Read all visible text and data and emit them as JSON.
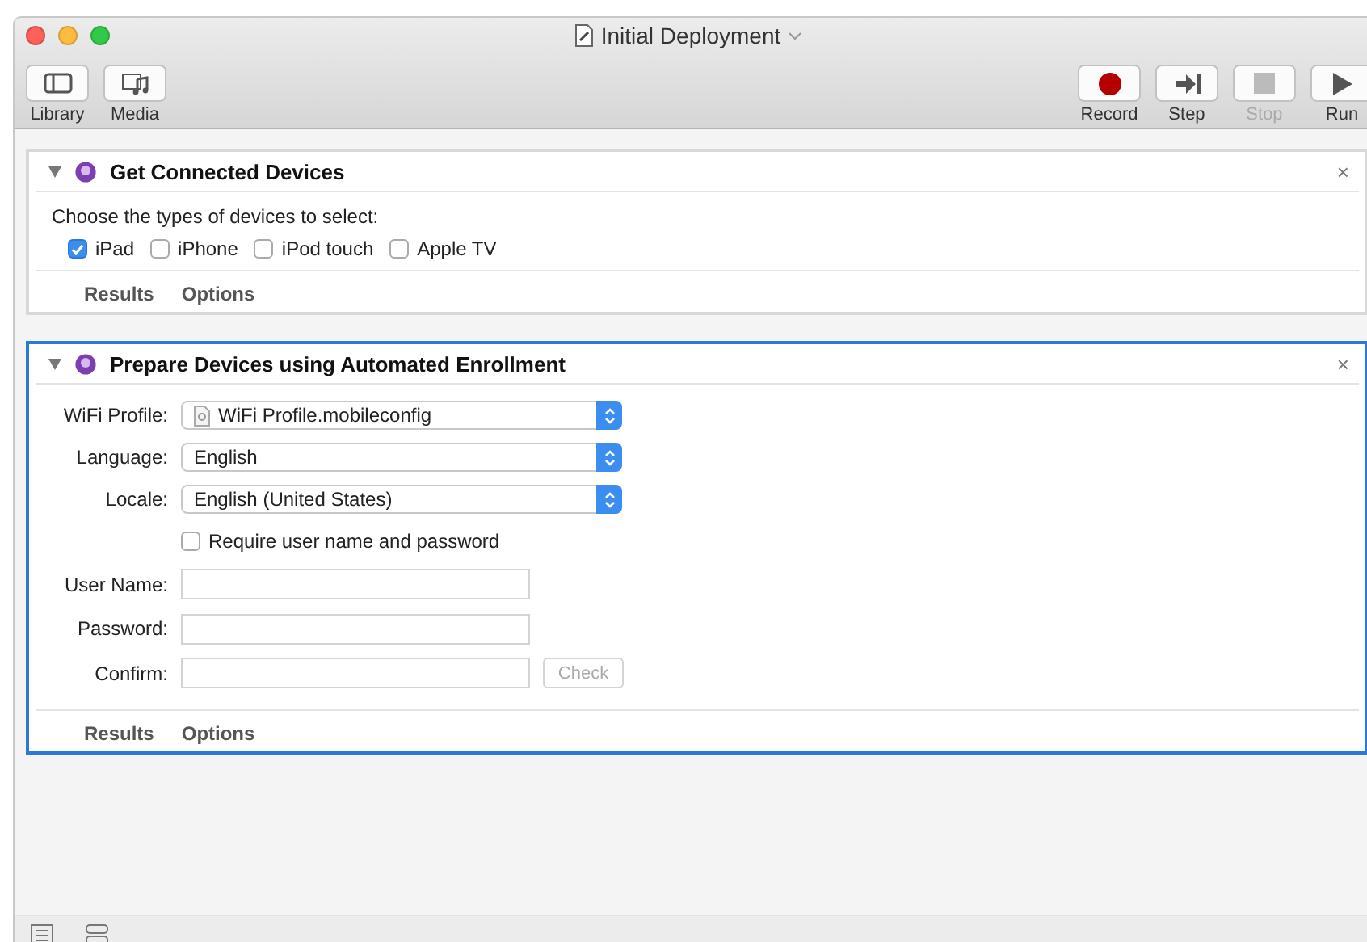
{
  "window": {
    "title": "Initial Deployment"
  },
  "toolbar_left": [
    {
      "kind": "library",
      "label": "Library",
      "disabled": false
    },
    {
      "kind": "media",
      "label": "Media",
      "disabled": false
    }
  ],
  "toolbar_right": [
    {
      "kind": "record",
      "label": "Record",
      "disabled": false
    },
    {
      "kind": "step",
      "label": "Step",
      "disabled": false
    },
    {
      "kind": "stop",
      "label": "Stop",
      "disabled": true
    },
    {
      "kind": "run",
      "label": "Run",
      "disabled": false
    }
  ],
  "actions": [
    {
      "title": "Get Connected Devices",
      "close": "×",
      "selected": false,
      "expanded": true,
      "kind": "devices",
      "prompt": "Choose the types of devices to select:",
      "options": [
        {
          "label": "iPad",
          "checked": true
        },
        {
          "label": "iPhone",
          "checked": false
        },
        {
          "label": "iPod touch",
          "checked": false
        },
        {
          "label": "Apple TV",
          "checked": false
        }
      ],
      "footer": [
        "Results",
        "Options"
      ]
    },
    {
      "title": "Prepare Devices using Automated Enrollment",
      "close": "×",
      "selected": true,
      "expanded": true,
      "kind": "enroll",
      "popups": [
        {
          "label": "WiFi Profile:",
          "value": "WiFi Profile.mobileconfig",
          "file": true
        },
        {
          "label": "Language:",
          "value": "English",
          "file": false
        },
        {
          "label": "Locale:",
          "value": "English (United States)",
          "file": false
        }
      ],
      "require": {
        "label": "Require user name and password",
        "checked": false
      },
      "fields": [
        {
          "label": "User Name:"
        },
        {
          "label": "Password:"
        },
        {
          "label": "Confirm:"
        }
      ],
      "check_button": {
        "label": "Check",
        "disabled": true
      },
      "footer": [
        "Results",
        "Options"
      ]
    }
  ]
}
